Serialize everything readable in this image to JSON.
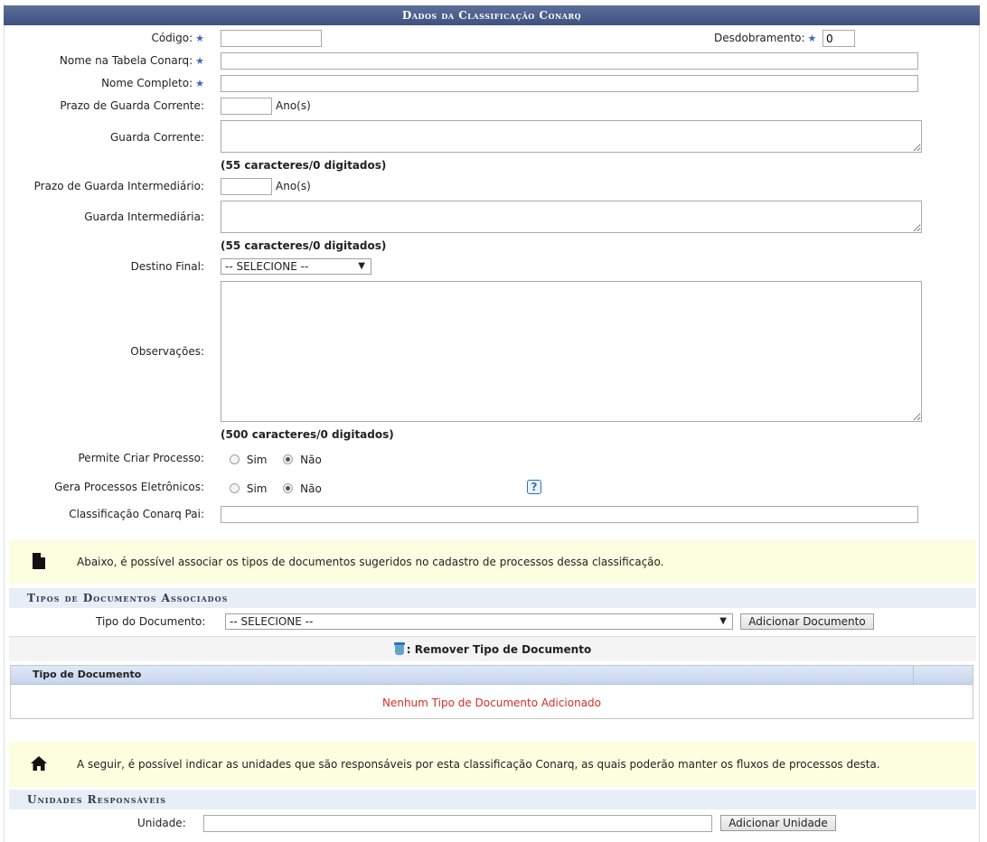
{
  "title": "Dados da Classificação Conarq",
  "form": {
    "codigo_label": "Código:",
    "desdobramento_label": "Desdobramento:",
    "desdobramento_value": "0",
    "nome_tabela_label": "Nome na Tabela Conarq:",
    "nome_completo_label": "Nome Completo:",
    "prazo_corrente_label": "Prazo de Guarda Corrente:",
    "anos_label": "Ano(s)",
    "guarda_corrente_label": "Guarda Corrente:",
    "guarda_corrente_count": "(55 caracteres/0 digitados)",
    "prazo_intermediario_label": "Prazo de Guarda Intermediário:",
    "guarda_intermediaria_label": "Guarda Intermediária:",
    "guarda_intermediaria_count": "(55 caracteres/0 digitados)",
    "destino_final_label": "Destino Final:",
    "destino_final_value": "-- SELECIONE --",
    "observacoes_label": "Observações:",
    "observacoes_count": "(500 caracteres/0 digitados)",
    "permite_criar_label": "Permite Criar Processo:",
    "gera_eletronicos_label": "Gera Processos Eletrônicos:",
    "sim_label": "Sim",
    "nao_label": "Não",
    "help_glyph": "?",
    "classificacao_pai_label": "Classificação Conarq Pai:"
  },
  "info_documentos": "Abaixo, é possível associar os tipos de documentos sugeridos no cadastro de processos dessa classificação.",
  "tipos_section": {
    "heading": "Tipos de Documentos Associados",
    "tipo_label": "Tipo do Documento:",
    "tipo_value": "-- SELECIONE --",
    "add_button": "Adicionar Documento",
    "legend_remove": ": Remover Tipo de Documento",
    "col_header": "Tipo de Documento",
    "empty_message": "Nenhum Tipo de Documento Adicionado"
  },
  "info_unidades": "A seguir, é possível indicar as unidades que são responsáveis por esta classificação Conarq, as quais poderão manter os fluxos de processos desta.",
  "unidades_section": {
    "heading": "Unidades Responsáveis",
    "unidade_label": "Unidade:",
    "add_button": "Adicionar Unidade"
  },
  "colors": {
    "header_bg": "#3e5280",
    "info_bg": "#fdfde0",
    "section_bg": "#e8eef6",
    "empty_text": "#d0302a",
    "required_star": "#3c6ab8"
  }
}
